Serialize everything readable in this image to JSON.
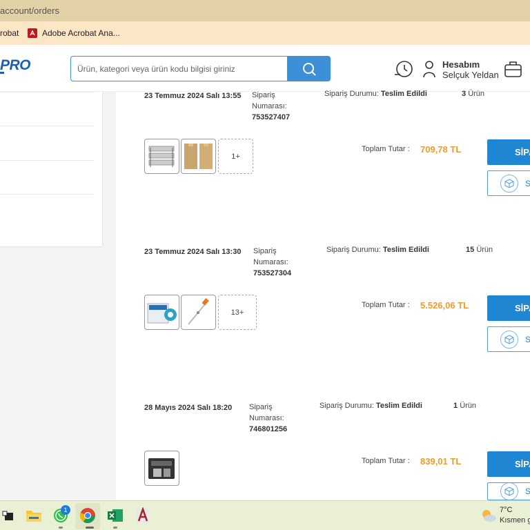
{
  "browser": {
    "url_text": "account/orders",
    "bookmarks": [
      {
        "label": "robat"
      },
      {
        "label": "Adobe Acrobat Ana..."
      }
    ]
  },
  "header": {
    "logo_text": "PRO",
    "search_placeholder": "Ürün, kategori veya ürün kodu bilgisi giriniz",
    "account_label": "Hesabım",
    "account_user": "Selçuk Yeldan"
  },
  "labels": {
    "order_number_label": "Sipariş Numarası:",
    "status_label": "Sipariş Durumu:",
    "total_label": "Toplam Tutar :",
    "products_suffix": "Ürün",
    "primary_button": "SİPA",
    "secondary_button": "S"
  },
  "orders": [
    {
      "date": "23 Temmuz 2024 Salı 13:55",
      "number": "753527407",
      "status": "Teslim Edildi",
      "count": "3",
      "more": "1+",
      "total": "709,78 TL"
    },
    {
      "date": "23 Temmuz 2024 Salı 13:30",
      "number": "753527304",
      "status": "Teslim Edildi",
      "count": "15",
      "more": "13+",
      "total": "5.526,06 TL"
    },
    {
      "date": "28 Mayıs 2024 Salı 18:20",
      "number": "746801256",
      "status": "Teslim Edildi",
      "count": "1",
      "more": "",
      "total": "839,01 TL"
    }
  ],
  "taskbar": {
    "whatsapp_badge": "1",
    "weather_temp": "7°C",
    "weather_desc": "Kısmen g"
  },
  "colors": {
    "accent": "#1f86d4",
    "price": "#f09a2b",
    "url_bar": "#e3d2a8",
    "bookmarks_bar": "#fbe6c6",
    "taskbar": "#e9f0d4"
  }
}
